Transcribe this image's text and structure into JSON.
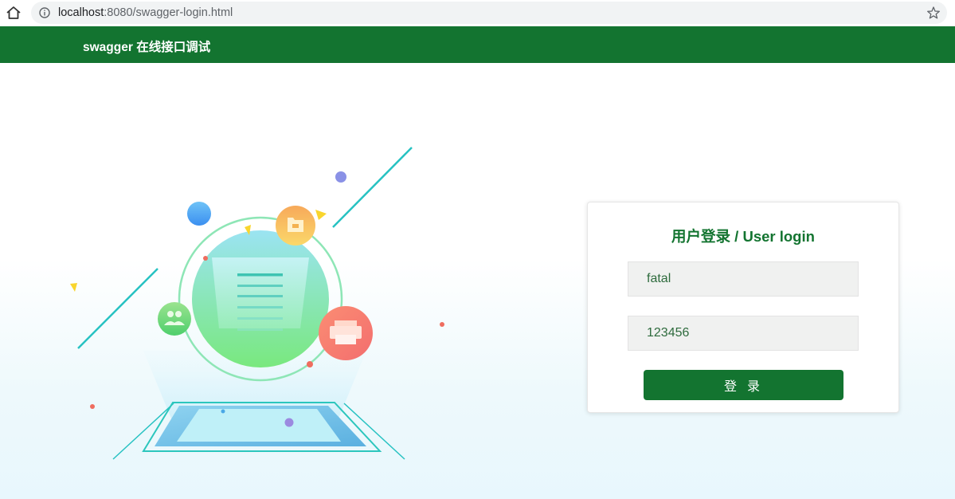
{
  "browser": {
    "url_host": "localhost",
    "url_rest": ":8080/swagger-login.html"
  },
  "header": {
    "title": "swagger 在线接口调试",
    "color": "#137430"
  },
  "login": {
    "title": "用户登录 / User login",
    "username_value": "fatal",
    "password_value": "123456",
    "submit_label": "登 录"
  },
  "icons": {
    "home": "home-icon",
    "info": "info-icon",
    "bookmark": "star-icon"
  }
}
